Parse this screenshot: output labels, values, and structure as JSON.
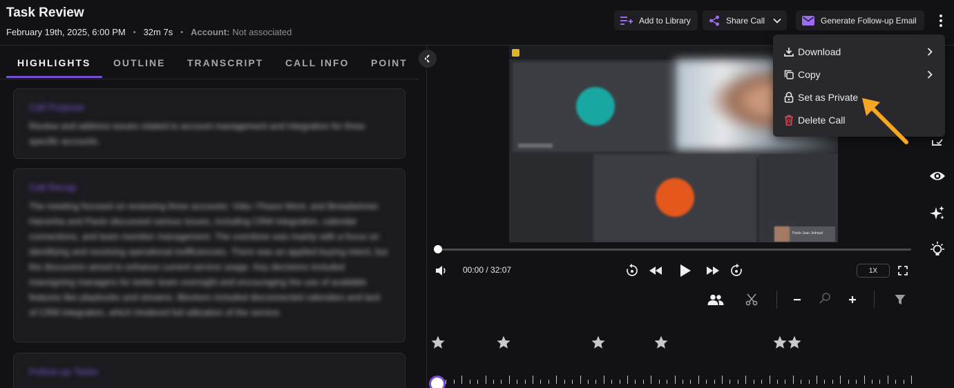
{
  "header": {
    "title": "Task Review",
    "date": "February 19th, 2025, 6:00 PM",
    "duration": "32m 7s",
    "account_label": "Account:",
    "account_value": "Not associated",
    "add_to_library": "Add to Library",
    "share_call": "Share Call",
    "generate_email": "Generate Follow-up Email"
  },
  "tabs": [
    "HIGHLIGHTS",
    "OUTLINE",
    "TRANSCRIPT",
    "CALL INFO",
    "POINT"
  ],
  "cards": [
    {
      "title": "Call Purpose",
      "body": "Review and address issues related to account management and integration for three specific accounts."
    },
    {
      "title": "Call Recap",
      "body": "The meeting focused on reviewing three accounts: Vida / Peace Mont, and Breadwinner. Harvinha and Paolo discussed various issues, including CRM integration, calendar connections, and team member management. The overdone was mainly with a focus on identifying and resolving operational inefficiencies. There was an applied buying intent, but the discussion aimed to enhance current service usage. Key decisions included reassigning managers for better team oversight and encouraging the use of available features like playbooks and streams. Blockers included disconnected calendars and lack of CRM integration, which hindered full utilization of the service."
    },
    {
      "title": "Follow-up Tasks",
      "body": ""
    }
  ],
  "video": {
    "thumbnail_name": "Paolo Juan Jeitraud"
  },
  "player": {
    "time": "00:00 / 32:07",
    "speed": "1X",
    "progress_fraction": 0
  },
  "menu": {
    "items": [
      {
        "label": "Download",
        "has_submenu": true
      },
      {
        "label": "Copy",
        "has_submenu": true
      },
      {
        "label": "Set as Private",
        "has_submenu": false
      },
      {
        "label": "Delete Call",
        "has_submenu": false
      }
    ]
  },
  "colors": {
    "accent": "#7a4fd1",
    "delete": "#e5484d",
    "arrow": "#f5a623"
  },
  "icons": [
    "playlist-add-icon",
    "share-icon",
    "chevron-down-icon",
    "mail-icon",
    "more-vertical-icon",
    "download-icon",
    "copy-icon",
    "lock-icon",
    "trash-icon",
    "chevron-right-icon",
    "chevron-left-icon",
    "volume-icon",
    "replay-icon",
    "rewind-icon",
    "play-icon",
    "fast-forward-icon",
    "forward-icon",
    "fullscreen-icon",
    "speakers-icon",
    "scissors-icon",
    "zoom-out-icon",
    "search-icon",
    "zoom-in-icon",
    "filter-icon",
    "star-icon",
    "eye-icon",
    "sparkles-icon",
    "lightbulb-icon",
    "checklist-icon"
  ]
}
